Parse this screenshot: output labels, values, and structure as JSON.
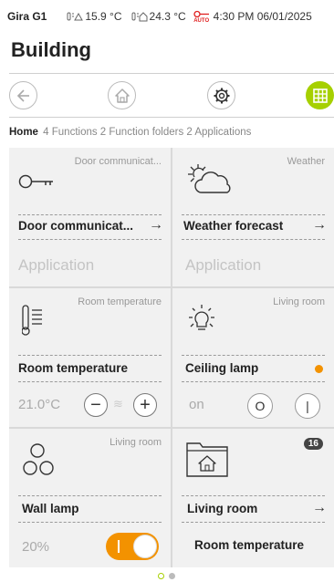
{
  "status": {
    "device": "Gira G1",
    "outdoor_temp": "15.9 °C",
    "indoor_temp": "24.3 °C",
    "auto_label": "AUTO",
    "datetime": "4:30 PM 06/01/2025"
  },
  "page_title": "Building",
  "toolbar": {
    "back_icon": "back-arrow-icon",
    "home_icon": "home-icon",
    "settings_icon": "gear-icon",
    "grid_icon": "grid-view-icon",
    "accent": "#a6d000"
  },
  "breadcrumb": {
    "home": "Home",
    "rest": "4 Functions 2 Function folders 2 Applications"
  },
  "tiles": {
    "door": {
      "context": "Door communicat...",
      "title": "Door communicat...",
      "subtitle": "Application",
      "icon": "key-icon"
    },
    "weather": {
      "context": "Weather",
      "title": "Weather forecast",
      "subtitle": "Application",
      "icon": "weather-icon"
    },
    "room_temp": {
      "context": "Room temperature",
      "title": "Room temperature",
      "value": "21.0°C",
      "minus": "−",
      "plus": "+",
      "icon": "thermometer-icon"
    },
    "ceiling": {
      "context": "Living room",
      "title": "Ceiling lamp",
      "value": "on",
      "off_label": "O",
      "on_label": "|",
      "status_color": "#f39200",
      "icon": "bulb-icon"
    },
    "wall": {
      "context": "Living room",
      "title": "Wall lamp",
      "value": "20%",
      "toggle_on": true,
      "toggle_color": "#f39200",
      "icon": "wall-lamp-icon"
    },
    "folder": {
      "badge": "16",
      "title": "Living room",
      "subtitle": "Room temperature",
      "icon": "folder-home-icon"
    }
  }
}
